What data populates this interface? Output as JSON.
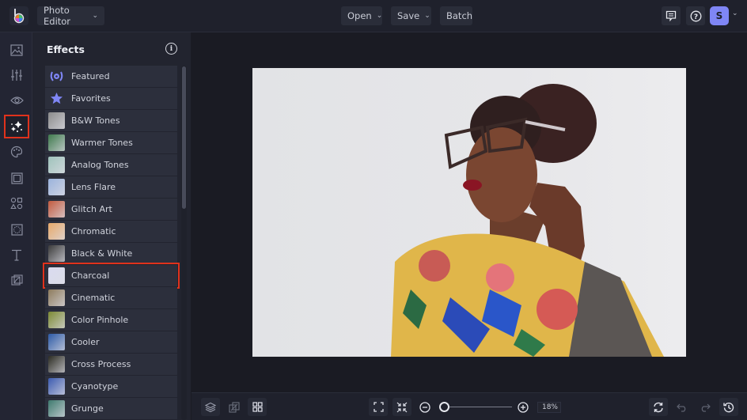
{
  "app": {
    "mode_menu": "Photo Editor",
    "colors": {
      "accent": "#7f86f5",
      "highlight": "#e0321c",
      "bg": "#1c1e28"
    }
  },
  "topbar": {
    "open_label": "Open",
    "save_label": "Save",
    "batch_label": "Batch",
    "avatar_initial": "S"
  },
  "rail": {
    "items": [
      {
        "name": "image-icon"
      },
      {
        "name": "adjust-sliders-icon"
      },
      {
        "name": "eye-icon"
      },
      {
        "name": "effects-sparkle-icon",
        "active": true
      },
      {
        "name": "palette-icon"
      },
      {
        "name": "frame-icon"
      },
      {
        "name": "graphics-shapes-icon"
      },
      {
        "name": "texture-icon"
      },
      {
        "name": "text-icon"
      },
      {
        "name": "overlay-icon"
      }
    ]
  },
  "panel": {
    "title": "Effects",
    "items": [
      {
        "label": "Featured",
        "thumb": "laurel"
      },
      {
        "label": "Favorites",
        "thumb": "star"
      },
      {
        "label": "B&W Tones",
        "thumb": "#8b8b8b"
      },
      {
        "label": "Warmer Tones",
        "thumb": "#3f7a4d"
      },
      {
        "label": "Analog Tones",
        "thumb": "#9fc3bb"
      },
      {
        "label": "Lens Flare",
        "thumb": "#9bb3dc"
      },
      {
        "label": "Glitch Art",
        "thumb": "#c25a3e"
      },
      {
        "label": "Chromatic",
        "thumb": "#e7a96a"
      },
      {
        "label": "Black & White",
        "thumb": "#3a3a3a"
      },
      {
        "label": "Charcoal",
        "thumb": "#d9dbf0",
        "selected": true
      },
      {
        "label": "Cinematic",
        "thumb": "#8d7b5c"
      },
      {
        "label": "Color Pinhole",
        "thumb": "#7c8a33"
      },
      {
        "label": "Cooler",
        "thumb": "#2c5aa6"
      },
      {
        "label": "Cross Process",
        "thumb": "#2b2b22"
      },
      {
        "label": "Cyanotype",
        "thumb": "#3c5bb0"
      },
      {
        "label": "Grunge",
        "thumb": "#3e7a6e"
      }
    ]
  },
  "bottombar": {
    "zoom_value": "18%",
    "zoom_fraction": 0.02
  }
}
